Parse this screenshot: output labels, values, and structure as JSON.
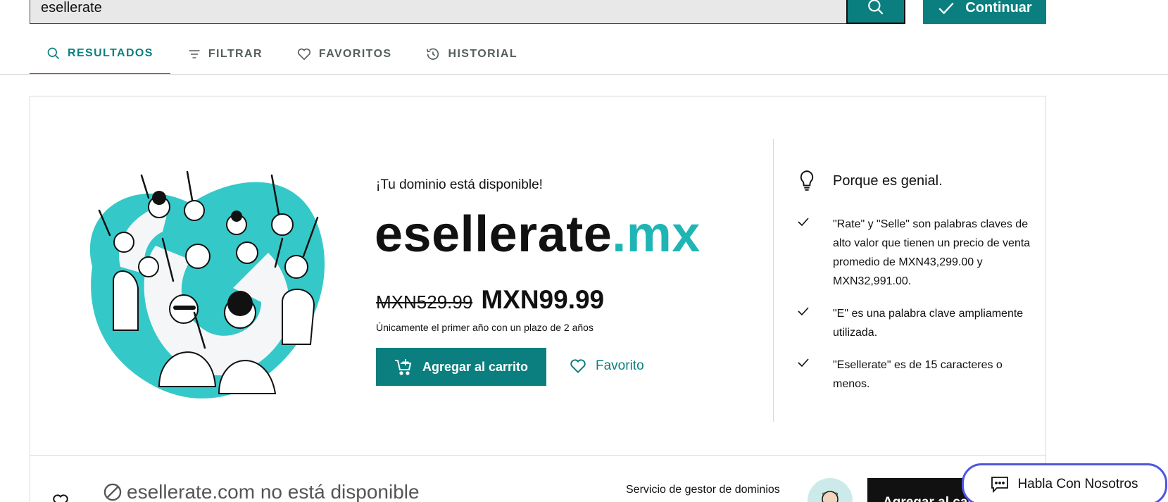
{
  "search": {
    "value": "esellerate",
    "button_icon": "search-icon",
    "continue_label": "Continuar"
  },
  "tabs": [
    {
      "label": "RESULTADOS",
      "icon": "search-icon",
      "active": true
    },
    {
      "label": "FILTRAR",
      "icon": "filter-icon",
      "active": false
    },
    {
      "label": "FAVORITOS",
      "icon": "heart-icon",
      "active": false
    },
    {
      "label": "HISTORIAL",
      "icon": "history-icon",
      "active": false
    }
  ],
  "result": {
    "available_title": "¡Tu dominio está disponible!",
    "domain_base": "esellerate",
    "domain_tld": ".mx",
    "old_price": "MXN529.99",
    "new_price": "MXN99.99",
    "price_note": "Únicamente el primer año con un plazo de 2 años",
    "add_to_cart": "Agregar al carrito",
    "favorite": "Favorito"
  },
  "why": {
    "heading": "Porque es genial.",
    "items": [
      "\"Rate\" y \"Selle\" son palabras claves de alto valor que tienen un precio de venta promedio de MXN43,299.00 y MXN32,991.00.",
      "\"E\" es una palabra clave ampliamente utilizada.",
      "\"Esellerate\" es de 15 caracteres o menos."
    ]
  },
  "second_result": {
    "unavailable": "esellerate.com no está disponible",
    "broker": "Servicio de gestor de dominios",
    "add_to_cart": "Agregar al carrito"
  },
  "chat": {
    "label": "Habla Con Nosotros"
  },
  "colors": {
    "brand_teal": "#0b7f7f",
    "tld_teal": "#1fb5b5",
    "illustration_teal": "#35c8c8",
    "chat_border": "#4d56e0"
  }
}
